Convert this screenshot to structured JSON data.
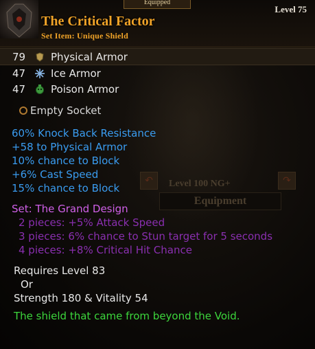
{
  "tooltip": {
    "equipped_tab": "Equipped",
    "level_label": "Level 75",
    "item_name": "The Critical Factor",
    "item_type": "Set Item: Unique Shield"
  },
  "base_stats": [
    {
      "value": "79",
      "label": "Physical Armor",
      "icon": "physical-armor-icon",
      "color": "#b89a50"
    },
    {
      "value": "47",
      "label": "Ice Armor",
      "icon": "ice-armor-icon",
      "color": "#8ab8e8"
    },
    {
      "value": "47",
      "label": "Poison Armor",
      "icon": "poison-armor-icon",
      "color": "#3e9a3e"
    }
  ],
  "socket": {
    "label": "Empty Socket",
    "icon": "socket-ring-icon"
  },
  "affixes": [
    "60% Knock Back Resistance",
    "+58 to Physical Armor",
    "10% chance to Block",
    "+6% Cast Speed",
    "15% chance to Block"
  ],
  "background_panel": {
    "level_text": "Level 100  NG+",
    "equipment_label": "Equipment"
  },
  "set": {
    "title": "Set: The Grand Design",
    "bonuses": [
      "2 pieces: +5% Attack Speed",
      "3 pieces: 6% chance to Stun target for 5 seconds",
      "4 pieces: +8% Critical Hit Chance"
    ]
  },
  "requirements": {
    "line1": "Requires Level 83",
    "line2": "Or",
    "line3": "Strength 180 & Vitality 54"
  },
  "flavor_text": "The shield that came from beyond the Void.",
  "colors": {
    "item_name": "#f0a328",
    "affix_blue": "#3a9cf0",
    "set_title": "#d060e8",
    "set_bonus": "#8a2fb0",
    "flavor_green": "#3cd63c"
  }
}
